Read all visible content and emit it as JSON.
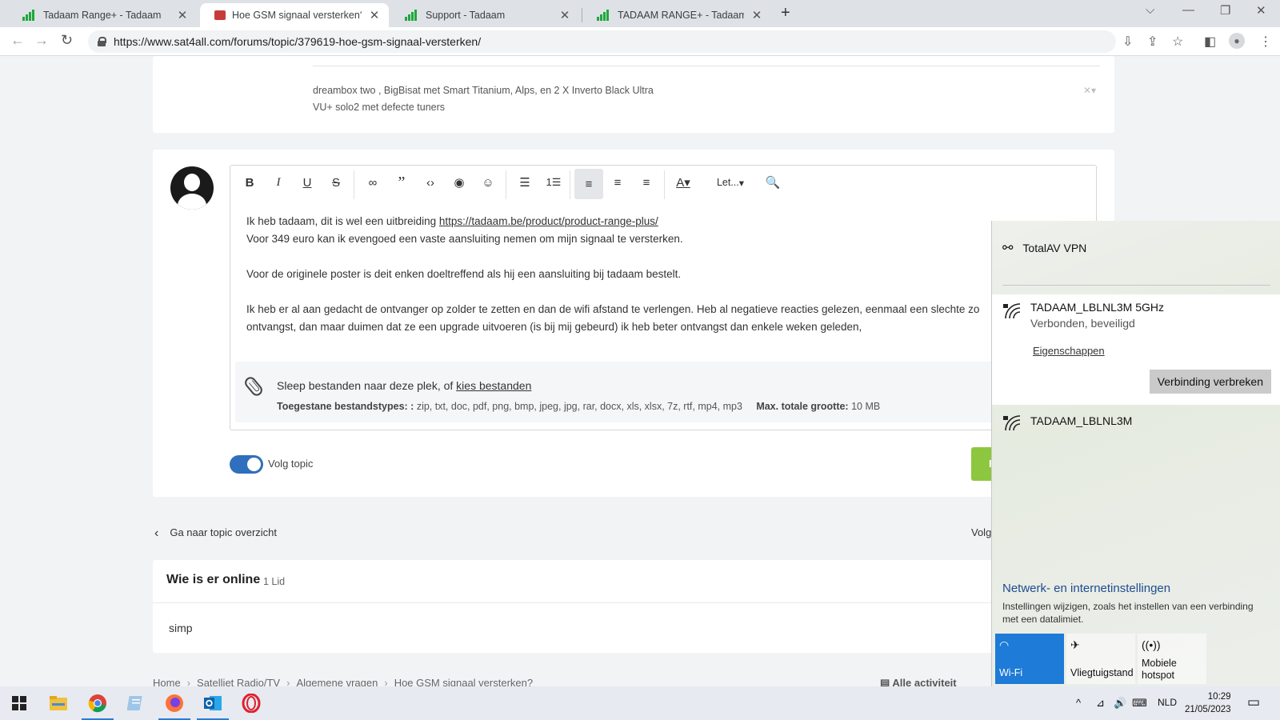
{
  "browser": {
    "tabs": [
      {
        "title": "Tadaam Range+ - Tadaam",
        "active": false
      },
      {
        "title": "Hoe GSM signaal versterken? - A",
        "active": true
      },
      {
        "title": "Support - Tadaam",
        "active": false
      },
      {
        "title": "TADAAM RANGE+ - Tadaam",
        "active": false
      }
    ],
    "url": "https://www.sat4all.com/forums/topic/379619-hoe-gsm-signaal-versterken/"
  },
  "signature": {
    "line1": "dreambox two ,  BigBisat met Smart Titanium, Alps, en 2 X Inverto Black Ultra",
    "line2": "VU+ solo2 met defecte tuners"
  },
  "editor": {
    "toolbar": {
      "bold": "B",
      "italic": "I",
      "underline": "U",
      "strike": "S",
      "font_label": "Let..."
    },
    "line1_text": "Ik heb tadaam, dit is wel een uitbreiding ",
    "line1_link": "https://tadaam.be/product/product-range-plus/",
    "line2": "Voor 349 euro kan ik evengoed een vaste aansluiting nemen om mijn signaal te versterken.",
    "line3": "Voor de originele poster is deit enken doeltreffend als hij een aansluiting bij tadaam bestelt.",
    "line4": "Ik heb er al aan gedacht de ontvanger op zolder te zetten en dan de wifi afstand te verlengen. Heb al negatieve reacties gelezen, eenmaal een slechte zo",
    "line5": "ontvangst, dan maar duimen dat ze een upgrade uitvoeren (is bij mij gebeurd) ik heb beter ontvangst dan enkele weken geleden,",
    "attach_text": "Sleep bestanden naar deze plek, of ",
    "attach_link": "kies bestanden",
    "types_label": "Toegestane bestandstypes: :",
    "types_value": " zip, txt, doc, pdf, png, bmp, jpeg, jpg, rar, docx, xls, xlsx, 7z, rtf, mp4, mp3",
    "max_label": "Max. totale grootte:",
    "max_value": " 10 MB"
  },
  "follow": {
    "label": "Volg topic",
    "on": true
  },
  "submit_label": "R",
  "back_link": "Ga naar topic overzicht",
  "follow_right": "Volg",
  "online": {
    "title": "Wie is er online",
    "count": "1 Lid",
    "member": "simp"
  },
  "breadcrumb": [
    "Home",
    "Satelliet Radio/TV",
    "Algemene vragen",
    "Hoe GSM signaal versterken?"
  ],
  "all_activity": "Alle activiteit",
  "network": {
    "vpn": "TotalAV VPN",
    "connected_name": "TADAAM_LBLNL3M 5GHz",
    "connected_status": "Verbonden, beveiligd",
    "properties": "Eigenschappen",
    "disconnect": "Verbinding verbreken",
    "other_name": "TADAAM_LBLNL3M",
    "settings_title": "Netwerk- en internetinstellingen",
    "settings_desc": "Instellingen wijzigen, zoals het instellen van een verbinding met een datalimiet.",
    "quick_actions": [
      {
        "label": "Wi-Fi",
        "on": true
      },
      {
        "label": "Vliegtuigstand",
        "on": false
      },
      {
        "label": "Mobiele hotspot",
        "on": false
      }
    ]
  },
  "taskbar": {
    "language": "NLD",
    "time": "10:29",
    "date": "21/05/2023"
  }
}
